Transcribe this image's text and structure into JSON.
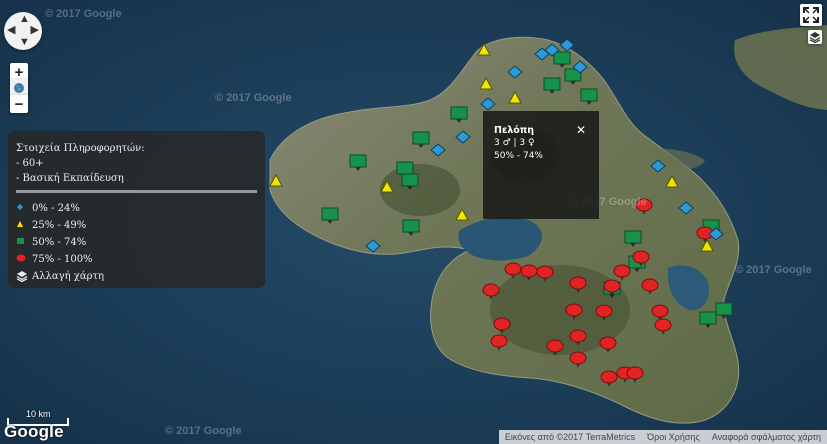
{
  "map": {
    "watermarks": [
      "© 2017 Google",
      "© 2017 Google",
      "© 2017 Google",
      "© 2017 Google",
      "© 2017 Google"
    ],
    "markers": {
      "blue": [
        [
          542,
          54
        ],
        [
          567,
          45
        ],
        [
          552,
          50
        ],
        [
          580,
          67
        ],
        [
          515,
          72
        ],
        [
          488,
          104
        ],
        [
          463,
          137
        ],
        [
          438,
          150
        ],
        [
          373,
          246
        ],
        [
          658,
          166
        ],
        [
          686,
          208
        ],
        [
          716,
          234
        ]
      ],
      "yellow": [
        [
          484,
          50
        ],
        [
          486,
          84
        ],
        [
          515,
          98
        ],
        [
          276,
          181
        ],
        [
          387,
          187
        ],
        [
          462,
          215
        ],
        [
          672,
          182
        ],
        [
          707,
          246
        ]
      ],
      "green": [
        [
          562,
          58
        ],
        [
          573,
          75
        ],
        [
          552,
          84
        ],
        [
          589,
          95
        ],
        [
          459,
          113
        ],
        [
          421,
          138
        ],
        [
          358,
          161
        ],
        [
          405,
          168
        ],
        [
          410,
          180
        ],
        [
          330,
          214
        ],
        [
          411,
          226
        ],
        [
          633,
          237
        ],
        [
          637,
          262
        ],
        [
          612,
          288
        ],
        [
          711,
          226
        ],
        [
          724,
          309
        ],
        [
          708,
          318
        ]
      ],
      "red": [
        [
          644,
          205
        ],
        [
          705,
          233
        ],
        [
          641,
          257
        ],
        [
          622,
          271
        ],
        [
          491,
          290
        ],
        [
          513,
          269
        ],
        [
          529,
          271
        ],
        [
          545,
          272
        ],
        [
          578,
          283
        ],
        [
          612,
          286
        ],
        [
          650,
          285
        ],
        [
          574,
          310
        ],
        [
          604,
          311
        ],
        [
          660,
          311
        ],
        [
          663,
          325
        ],
        [
          502,
          324
        ],
        [
          499,
          341
        ],
        [
          555,
          346
        ],
        [
          578,
          336
        ],
        [
          608,
          343
        ],
        [
          578,
          358
        ],
        [
          609,
          377
        ],
        [
          625,
          373
        ],
        [
          635,
          373
        ]
      ]
    }
  },
  "controls": {
    "zoom_in": "+",
    "zoom_out": "−",
    "fullscreen_icon": "fullscreen-icon",
    "layers_icon": "layers-icon"
  },
  "legend": {
    "title": "Στοιχεία Πληροφορητών:",
    "line1": "- 60+",
    "line2": "- Βασική Εκπαίδευση",
    "items": [
      {
        "label": "0% - 24%",
        "shape": "diamond",
        "color": "#2b9ad6"
      },
      {
        "label": "25% - 49%",
        "shape": "triangle",
        "color": "#f2e600"
      },
      {
        "label": "50% - 74%",
        "shape": "square",
        "color": "#16924a"
      },
      {
        "label": "75% - 100%",
        "shape": "pin",
        "color": "#e02424"
      }
    ],
    "change_map": "Αλλαγή χάρτη"
  },
  "popup": {
    "title": "Πελόπη",
    "counts": "3 ♂ | 3 ♀",
    "range": "50% - 74%",
    "close": "✕"
  },
  "attribution": {
    "imagery": "Εικόνες από ©2017 TerraMetrics",
    "terms": "Όροι Χρήσης",
    "report": "Αναφορά σφάλματος χάρτη"
  },
  "scale": "10 km",
  "google_logo": "Google"
}
